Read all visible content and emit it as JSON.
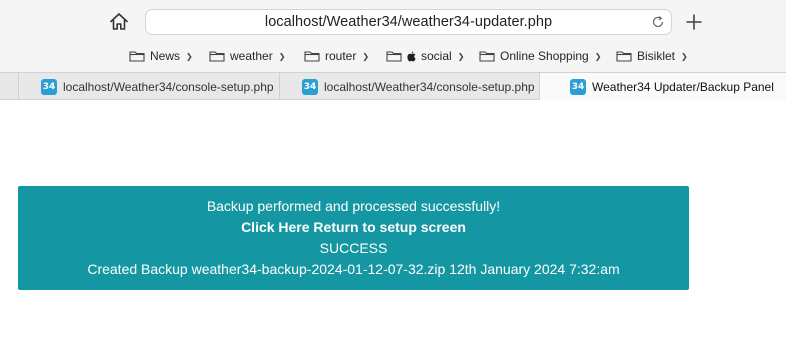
{
  "toolbar": {
    "url": "localhost/Weather34/weather34-updater.php"
  },
  "bookmarks": [
    {
      "label": "News",
      "has_chevron": true
    },
    {
      "label": "weather",
      "has_chevron": true
    },
    {
      "label": "router",
      "has_chevron": true
    },
    {
      "label": "social",
      "has_chevron": true,
      "apple_prefix": true
    },
    {
      "label": "Online Shopping",
      "has_chevron": true
    },
    {
      "label": "Bisiklet",
      "has_chevron": true
    }
  ],
  "tabs": [
    {
      "label": "localhost/Weather34/console-setup.php",
      "icon_text": "34",
      "active": false
    },
    {
      "label": "localhost/Weather34/console-setup.php",
      "icon_text": "34",
      "active": false
    },
    {
      "label": "Weather34 Updater/Backup Panel",
      "icon_text": "34",
      "active": true
    }
  ],
  "banner": {
    "line1": "Backup performed and processed successfully!",
    "link": "Click Here Return to setup screen",
    "status": "SUCCESS",
    "created": "Created Backup weather34-backup-2024-01-12-07-32.zip 12th January 2024 7:32:am",
    "bg_color": "#1597a3"
  }
}
